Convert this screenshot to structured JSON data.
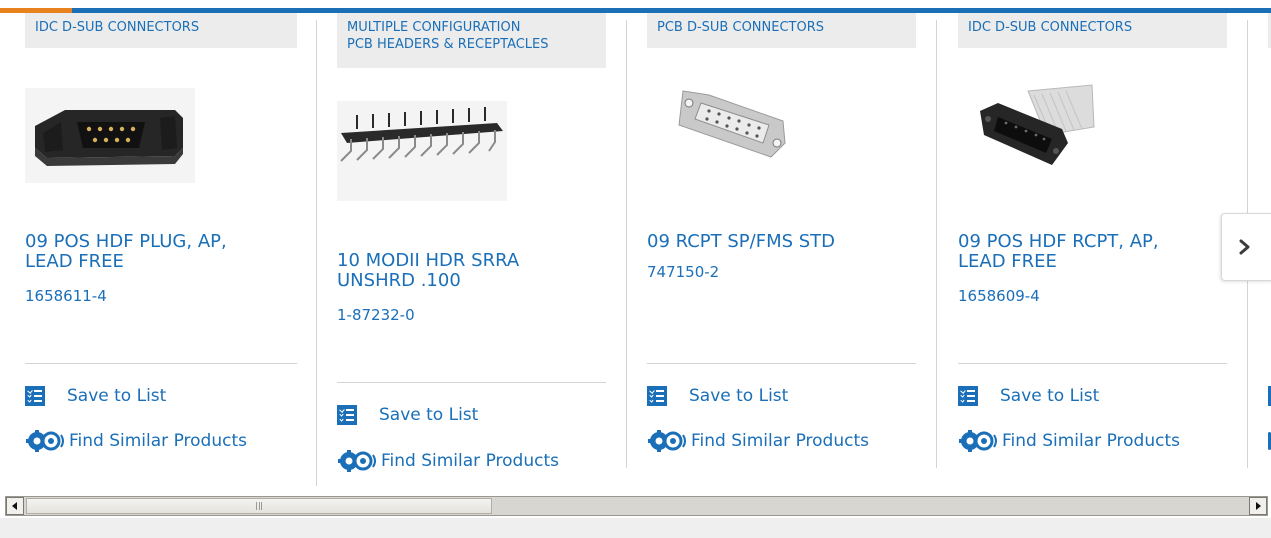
{
  "cards": [
    {
      "category": "IDC D-SUB CONNECTORS",
      "title": "09 POS HDF PLUG, AP, LEAD FREE",
      "title_lines": [
        "09 POS HDF PLUG, AP,",
        "LEAD FREE"
      ],
      "part_number": "1658611-4",
      "save_label": "Save to List",
      "find_label": "Find Similar Products"
    },
    {
      "category": "MULTIPLE CONFIGURATION PCB HEADERS & RECEPTACLES",
      "category_lines": [
        "MULTIPLE CONFIGURATION",
        "PCB HEADERS & RECEPTACLES"
      ],
      "title": "10 MODII HDR SRRA UNSHRD .100",
      "title_lines": [
        "10 MODII HDR SRRA",
        "UNSHRD .100"
      ],
      "part_number": "1-87232-0",
      "save_label": "Save to List",
      "find_label": "Find Similar Products"
    },
    {
      "category": "PCB D-SUB CONNECTORS",
      "title": "09 RCPT SP/FMS STD",
      "title_lines": [
        "09 RCPT SP/FMS STD"
      ],
      "part_number": "747150-2",
      "save_label": "Save to List",
      "find_label": "Find Similar Products"
    },
    {
      "category": "IDC D-SUB CONNECTORS",
      "title": "09 POS HDF RCPT, AP, LEAD FREE",
      "title_lines": [
        "09 POS HDF RCPT, AP,",
        "LEAD FREE"
      ],
      "part_number": "1658609-4",
      "save_label": "Save to List",
      "find_label": "Find Similar Products"
    }
  ],
  "icons": {
    "save": "list-check-icon",
    "find": "gears-icon",
    "next": "chevron-right-icon",
    "scroll_left": "scroll-left-arrow-icon",
    "scroll_right": "scroll-right-arrow-icon"
  },
  "colors": {
    "link": "#1a6fb8",
    "accent_orange": "#e8821e",
    "top_line_blue": "#1c6fb5",
    "category_bg": "#ececec"
  },
  "carousel": {
    "scroll_position": 0.0
  }
}
